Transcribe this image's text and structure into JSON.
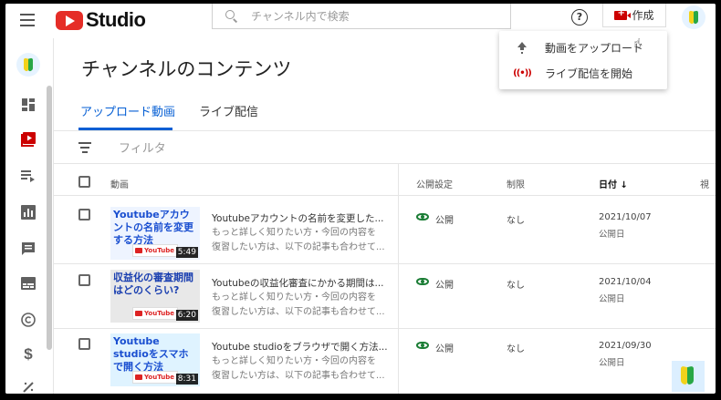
{
  "header": {
    "logo_text": "Studio",
    "search_placeholder": "チャンネル内で検索",
    "help_symbol": "?",
    "create_label": "作成"
  },
  "dropdown": {
    "items": [
      {
        "label": "動画をアップロード",
        "icon": "upload-icon"
      },
      {
        "label": "ライブ配信を開始",
        "icon": "live-icon"
      }
    ]
  },
  "sidebar": {
    "items": [
      "dashboard-icon",
      "content-icon",
      "playlists-icon",
      "analytics-icon",
      "comments-icon",
      "subtitles-icon",
      "copyright-icon",
      "monetization-icon",
      "customization-icon"
    ]
  },
  "main": {
    "title": "チャンネルのコンテンツ",
    "tabs": [
      {
        "label": "アップロード動画"
      },
      {
        "label": "ライブ配信"
      }
    ],
    "filter_label": "フィルタ",
    "columns": {
      "video": "動画",
      "visibility": "公開設定",
      "restrictions": "制限",
      "date": "日付 ↓",
      "views": "視"
    },
    "rows": [
      {
        "thumb_text": "Youtubeアカウントの名前を変更する方法",
        "thumb_badge": "YouTube",
        "duration": "5:49",
        "title": "Youtubeアカウントの名前を変更した...",
        "desc1": "もっと詳しく知りたい方・今回の内容を",
        "desc2": "復習したい方は、以下の記事も合わせて...",
        "visibility": "公開",
        "restriction": "なし",
        "date": "2021/10/07",
        "date_sub": "公開日"
      },
      {
        "thumb_text": "収益化の審査期間はどのくらい?",
        "thumb_badge": "YouTube",
        "duration": "6:20",
        "title": "Youtubeの収益化審査にかかる期間は...",
        "desc1": "もっと詳しく知りたい方・今回の内容を",
        "desc2": "復習したい方は、以下の記事も合わせて...",
        "visibility": "公開",
        "restriction": "なし",
        "date": "2021/10/04",
        "date_sub": "公開日"
      },
      {
        "thumb_text": "Youtube studioをスマホで開く方法",
        "thumb_badge": "YouTube",
        "duration": "8:31",
        "title": "Youtube studioをブラウザで開く方法...",
        "desc1": "もっと詳しく知りたい方・今回の内容を",
        "desc2": "復習したい方は、以下の記事も合わせて...",
        "visibility": "公開",
        "restriction": "なし",
        "date": "2021/09/30",
        "date_sub": "公開日"
      }
    ]
  },
  "colors": {
    "accent": "#065fd4",
    "brand_red": "#e52d27",
    "public_green": "#1b7d35"
  }
}
